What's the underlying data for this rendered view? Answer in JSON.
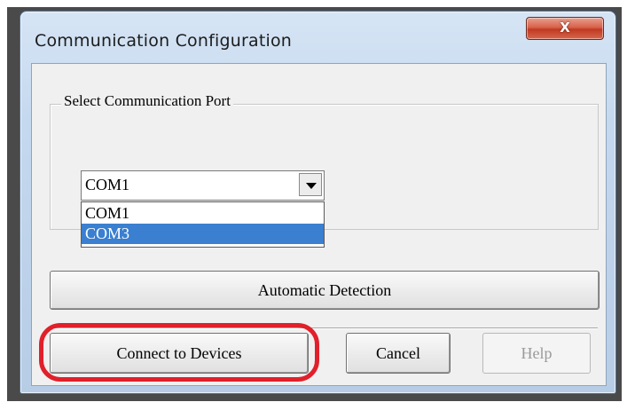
{
  "window": {
    "title": "Communication Configuration",
    "close_glyph": "X"
  },
  "port_group": {
    "label": "Select Communication Port",
    "selected_value": "COM1",
    "options": [
      "COM1",
      "COM3"
    ],
    "highlighted_option": "COM3"
  },
  "buttons": {
    "auto_detect": "Automatic Detection",
    "connect": "Connect to Devices",
    "cancel": "Cancel",
    "help": "Help"
  },
  "annotation": {
    "highlight_color": "#e0202a",
    "highlighted_target": "connect-button"
  },
  "icons": {
    "close": "close-icon",
    "dropdown": "chevron-down-icon"
  }
}
